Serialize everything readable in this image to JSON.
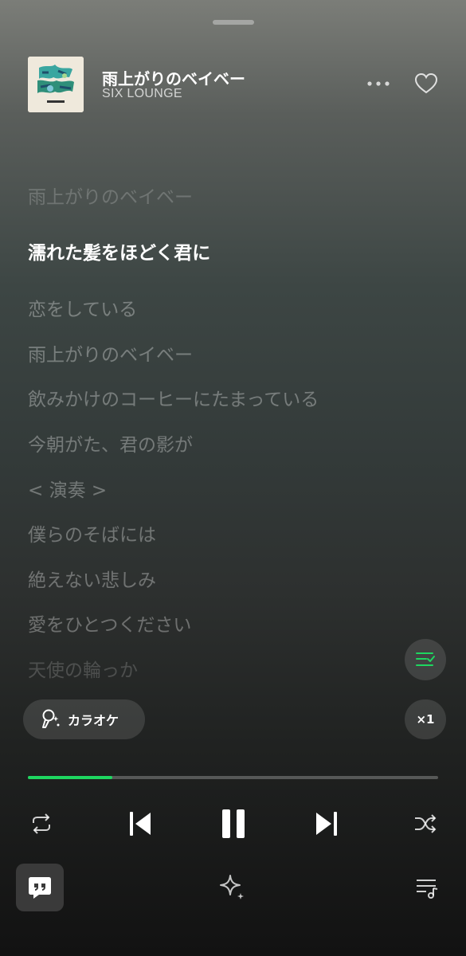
{
  "track": {
    "title": "雨上がりのベイベー",
    "artist": "SIX LOUNGE"
  },
  "lyrics": [
    {
      "text": "雨上がりのベイベー",
      "state": "past"
    },
    {
      "text": "濡れた髪をほどく君に",
      "state": "active"
    },
    {
      "text": "恋をしている",
      "state": "upcoming"
    },
    {
      "text": "雨上がりのベイベー",
      "state": "upcoming"
    },
    {
      "text": "飲みかけのコーヒーにたまっている",
      "state": "upcoming"
    },
    {
      "text": "今朝がた、君の影が",
      "state": "upcoming"
    },
    {
      "text": "< 演奏 >",
      "state": "upcoming"
    },
    {
      "text": "僕らのそばには",
      "state": "upcoming"
    },
    {
      "text": "絶えない悲しみ",
      "state": "upcoming"
    },
    {
      "text": "愛をひとつください",
      "state": "upcoming"
    },
    {
      "text": "天使の輪っか",
      "state": "upcoming"
    }
  ],
  "karaoke": {
    "label": "カラオケ"
  },
  "speed": {
    "label": "×1"
  },
  "playback": {
    "progress": 0.205,
    "state": "playing"
  },
  "colors": {
    "accent": "#1ed760",
    "background_top": "#7b7d78",
    "background_bottom": "#121212"
  },
  "icons": [
    "more-icon",
    "heart-icon",
    "lyrics-list-icon",
    "microphone-icon",
    "repeat-icon",
    "previous-icon",
    "pause-icon",
    "next-icon",
    "shuffle-icon",
    "quote-icon",
    "sparkle-icon",
    "queue-icon"
  ]
}
